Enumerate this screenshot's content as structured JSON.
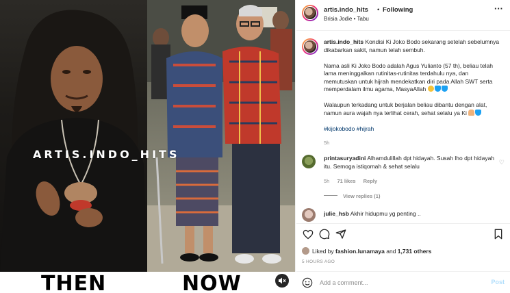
{
  "media": {
    "watermark": "ARTIS.INDO_HITS",
    "label_then": "THEN",
    "label_now": "NOW",
    "mute_icon": "speaker-muted-icon"
  },
  "header": {
    "username": "artis.indo_hits",
    "separator": "•",
    "follow_status": "Following",
    "subtitle": "Brisia Jodie • Tabu",
    "more_icon": "more-dots-icon"
  },
  "caption": {
    "username": "artis.indo_hits",
    "paragraphs": [
      "Kondisi Ki Joko Bodo sekarang setelah sebelumnya dikabarkan sakit, namun telah sembuh.",
      "Nama asli Ki Joko Bodo adalah Agus Yulianto (57 th), beliau telah lama meninggalkan rutinitas-rutinitas terdahulu nya, dan memutuskan untuk hijrah mendekatkan diri pada Allah SWT serta memperdalam ilmu agama, MasyaAllah",
      "Walaupun terkadang untuk berjalan beliau dibantu dengan alat, namun aura wajah nya terlihat cerah, sehat selalu ya Ki"
    ],
    "hashtags": "#kijokobodo #hijrah",
    "time": "5h"
  },
  "comments": [
    {
      "username": "printasuryadini",
      "text": "Alhamdulillah dpt hidayah. Susah lho dpt hidayah itu. Semoga istiqomah & sehat selalu",
      "time": "5h",
      "likes": "71 likes",
      "reply": "Reply",
      "view_replies": "View replies (1)"
    },
    {
      "username": "julie_hsb",
      "text": "Akhir hidupmu yg penting ..",
      "time": "",
      "likes": "",
      "reply": ""
    }
  ],
  "actions": {
    "liked_by_prefix": "Liked by",
    "liked_by_user": "fashion.lunamaya",
    "liked_by_and": "and",
    "liked_by_others": "1,731 others",
    "posted_ago": "5 HOURS AGO"
  },
  "add_comment": {
    "placeholder": "Add a comment...",
    "post_label": "Post"
  },
  "colors": {
    "link": "#00376b",
    "muted": "#8e8e8e",
    "post_disabled": "#b2dffc"
  }
}
